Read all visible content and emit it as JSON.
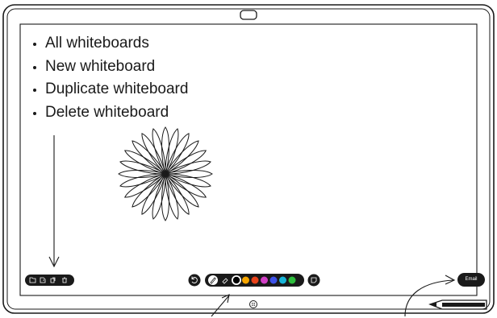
{
  "menu": {
    "items": [
      "All whiteboards",
      "New whiteboard",
      "Duplicate whiteboard",
      "Delete whiteboard"
    ]
  },
  "email_button": {
    "label": "Email"
  },
  "toolbar": {
    "left_icons": [
      "folder-icon",
      "new-board-icon",
      "duplicate-icon",
      "trash-icon"
    ],
    "tools": [
      "undo-icon",
      "pen-icon",
      "eraser-icon"
    ],
    "palette": [
      "#000000",
      "#f7a600",
      "#e8421a",
      "#d23fc6",
      "#3d52e8",
      "#18b4d8",
      "#2dbe3c"
    ],
    "sticky_note_icon": "sticky-note-icon"
  },
  "colors": {
    "frame": "#1a1a1a",
    "screen": "#ffffff",
    "bezel": "#ffffff"
  }
}
